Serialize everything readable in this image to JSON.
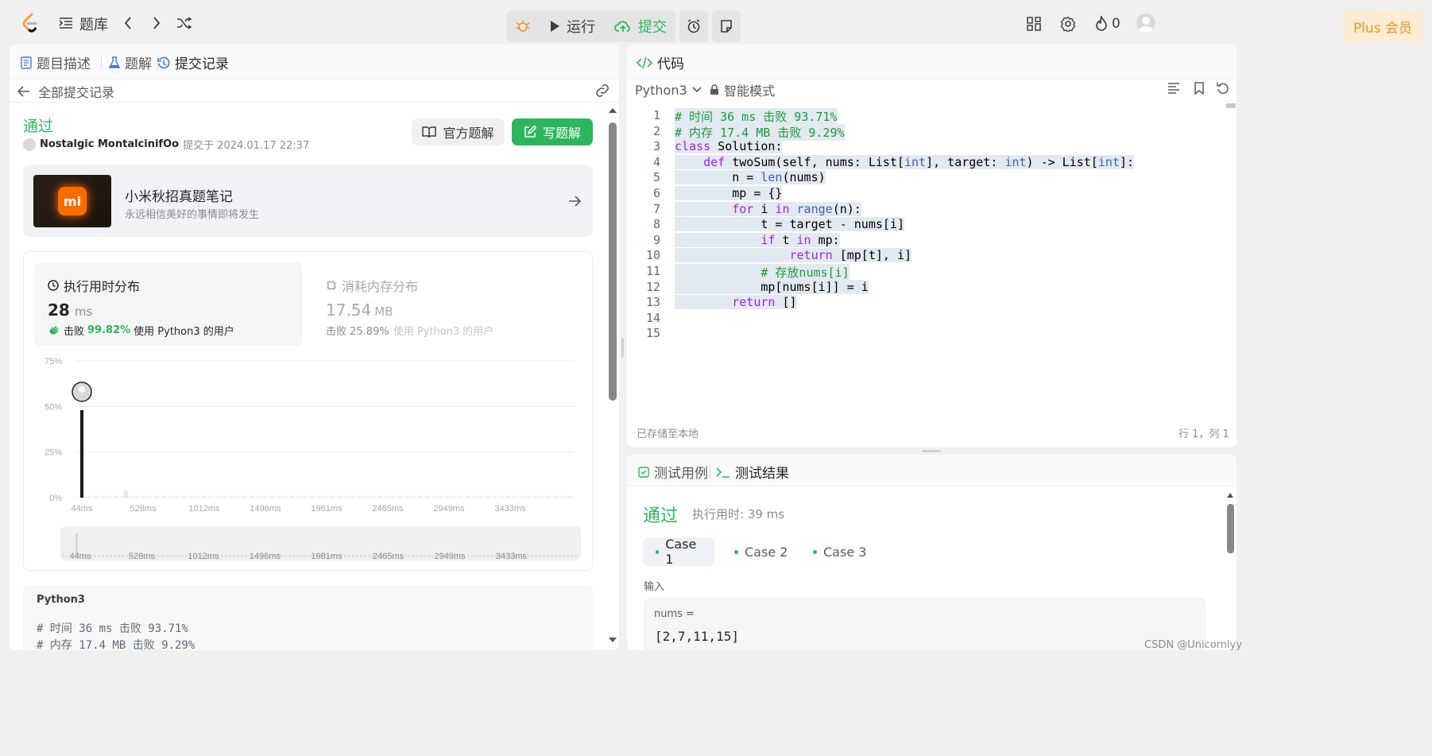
{
  "topbar": {
    "problems_label": "题库",
    "run_label": "运行",
    "submit_label": "提交",
    "streak_count": "0",
    "plus_label": "Plus 会员"
  },
  "left_panel": {
    "tabs": [
      {
        "label": "题目描述",
        "icon": "document-icon"
      },
      {
        "label": "题解",
        "icon": "flask-icon"
      },
      {
        "label": "提交记录",
        "icon": "history-icon"
      }
    ],
    "back_label": "全部提交记录",
    "status": "通过",
    "user_name": "Nostalgic MontalcinifOo",
    "submitted_at": "提交于 2024.01.17 22:37",
    "official_solution_label": "官方题解",
    "write_solution_label": "写题解",
    "promo": {
      "title": "小米秋招真题笔记",
      "subtitle": "永远相信美好的事情即将发生",
      "logo_text": "mi"
    },
    "runtime": {
      "label": "执行用时分布",
      "value": "28",
      "unit": "ms",
      "beats_prefix": "击败",
      "beats_pct": "99.82%",
      "beats_suffix": "使用 Python3 的用户"
    },
    "memory": {
      "label": "消耗内存分布",
      "value": "17.54",
      "unit": "MB",
      "beats_text": "击败 25.89%",
      "beats_suffix": "使用 Python3 的用户"
    },
    "code_preview": {
      "language": "Python3",
      "line1": "# 时间 36 ms 击败 93.71%",
      "line2": "# 内存 17.4 MB 击败 9.29%"
    }
  },
  "chart_data": {
    "type": "bar",
    "y_ticks": [
      "75%",
      "50%",
      "25%",
      "0%"
    ],
    "ylim": [
      0,
      75
    ],
    "x_ticks": [
      "44ms",
      "528ms",
      "1012ms",
      "1496ms",
      "1981ms",
      "2465ms",
      "2949ms",
      "3433ms"
    ],
    "xlim": [
      44,
      3800
    ],
    "highlight_bar": {
      "x": 44,
      "value": 48
    },
    "minor_bars_value": 1,
    "grid": true,
    "legend": "none"
  },
  "editor": {
    "tab_label": "代码",
    "language": "Python3",
    "mode": "智能模式",
    "saved_status": "已存储至本地",
    "cursor_position": "行 1，列 1",
    "line_numbers": [
      "1",
      "2",
      "3",
      "4",
      "5",
      "6",
      "7",
      "8",
      "9",
      "10",
      "11",
      "12",
      "13",
      "14",
      "15"
    ]
  },
  "results": {
    "tab_cases": "测试用例",
    "tab_result": "测试结果",
    "status": "通过",
    "runtime": "执行用时: 39 ms",
    "cases": [
      "Case 1",
      "Case 2",
      "Case 3"
    ],
    "input_label": "输入",
    "param_name": "nums =",
    "param_value": "[2,7,11,15]"
  },
  "watermark": "CSDN @Unicornlyy",
  "colors": {
    "accent_green": "#2db55d",
    "plus_orange": "#e69526"
  }
}
